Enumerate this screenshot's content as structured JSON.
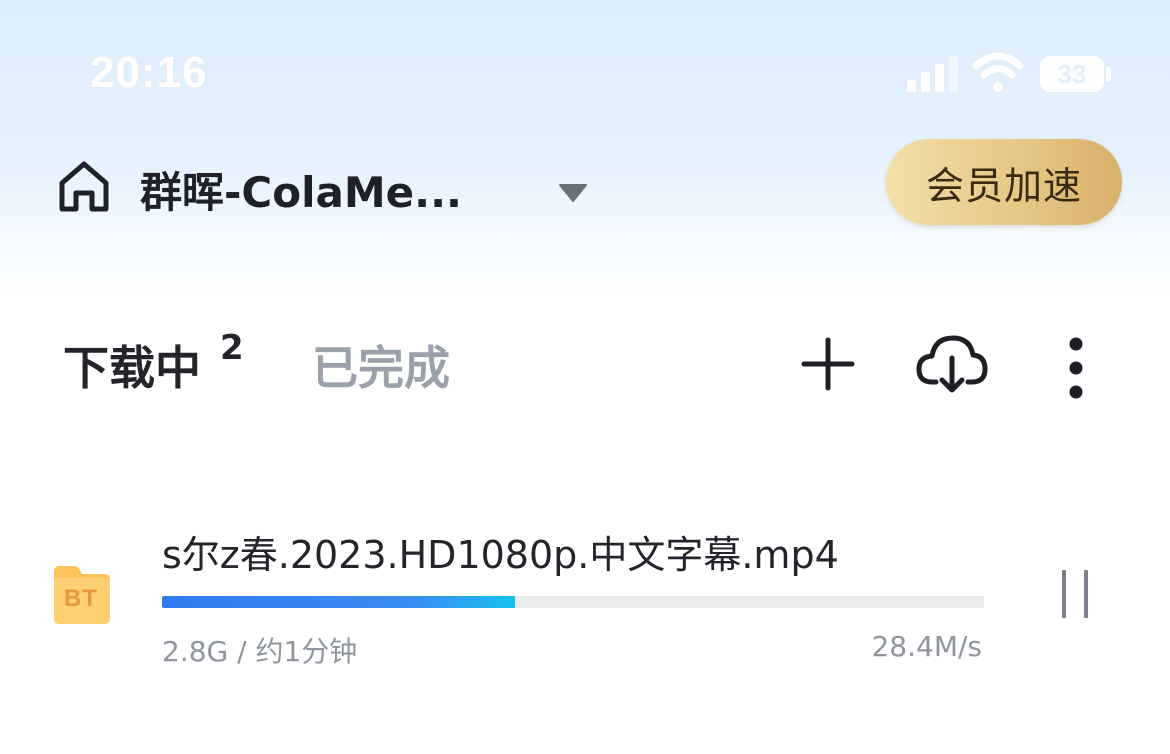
{
  "status_bar": {
    "time": "20:16",
    "battery": "33"
  },
  "header": {
    "device_name": "群晖-ColaMe...",
    "vip_button": "会员加速"
  },
  "tabs": {
    "downloading_label": "下载中",
    "downloading_count": "2",
    "completed_label": "已完成"
  },
  "toolbar": {
    "add_icon": "plus-icon",
    "cloud_download_icon": "cloud-download-icon",
    "more_icon": "more-vertical-icon"
  },
  "tasks": [
    {
      "type_badge": "BT",
      "filename": "s尔z春.2023.HD1080p.中文字幕.mp4",
      "progress": 0.43,
      "meta": "2.8G / 约1分钟",
      "speed": "28.4M/s",
      "action_icon": "pause-icon"
    }
  ],
  "colors": {
    "progress_start": "#2e7bf0",
    "progress_end": "#17c0ee",
    "vip_gold": "#e6c886",
    "bt_folder": "#ffc35c"
  }
}
